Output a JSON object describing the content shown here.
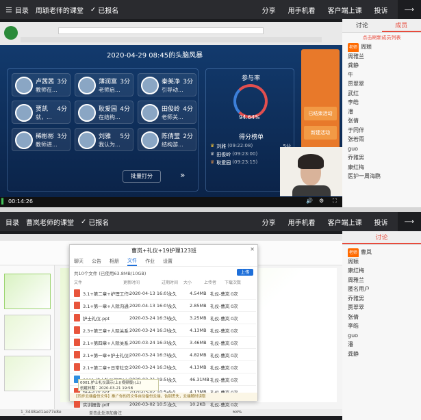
{
  "top": {
    "title_icon": "list-icon",
    "menu_label": "目录",
    "course": "周颖老师的课堂",
    "signin": "已报名",
    "share": "分享",
    "phone": "用手机看",
    "client": "客户端上课",
    "complaint": "投诉"
  },
  "top_chat": {
    "tabs": [
      "讨论",
      "成员"
    ],
    "notice": "点击刷新成员列表",
    "members": [
      {
        "name": "周颖",
        "badge": "老师"
      },
      {
        "name": "周雅兰"
      },
      {
        "name": "龚静"
      },
      {
        "name": "牛"
      },
      {
        "name": "贾翠翠"
      },
      {
        "name": "武红"
      },
      {
        "name": "李皓"
      },
      {
        "name": "潘"
      },
      {
        "name": "张倩"
      },
      {
        "name": "于同伴"
      },
      {
        "name": "张若雨"
      },
      {
        "name": "guo"
      },
      {
        "name": "乔雅男"
      },
      {
        "name": "康红梅"
      },
      {
        "name": "医护一周海鹏"
      }
    ]
  },
  "top_screen": {
    "session": "2020-04-29 08:45的头脑风暴",
    "students": [
      {
        "name": "卢茜茜",
        "score": "3分",
        "desc": "教师在..."
      },
      {
        "name": "薄润富",
        "score": "3分",
        "desc": "老师启..."
      },
      {
        "name": "秦美净",
        "score": "3分",
        "desc": "引导动..."
      },
      {
        "name": "贾凯",
        "score": "4分",
        "desc": "就，..."
      },
      {
        "name": "耿爱园",
        "score": "4分",
        "desc": "在结构..."
      },
      {
        "name": "田俊岭",
        "score": "4分",
        "desc": "老师关..."
      },
      {
        "name": "稀彬彬",
        "score": "3分",
        "desc": "教师进..."
      },
      {
        "name": "刘雅",
        "score": "5分",
        "desc": "我认为..."
      },
      {
        "name": "陈倩莹",
        "score": "2分",
        "desc": "结构游..."
      }
    ],
    "batch_btn": "批量打分",
    "participation_title": "参与率",
    "participation_value": "94.64%",
    "participation_value_num": 94.64,
    "leaderboard_title": "得分榜单",
    "leaders": [
      {
        "name": "刘雅",
        "time": "(09:22:08)",
        "score": "5分"
      },
      {
        "name": "田俊岭",
        "time": "(09:23:00)",
        "score": "4分"
      },
      {
        "name": "耿爱园",
        "time": "(09:23:15)",
        "score": "4分"
      }
    ],
    "side_buttons": [
      "已结束活动",
      "新建活动"
    ],
    "time": "00:14:26"
  },
  "bottom": {
    "menu_label": "目录",
    "course": "曹岚老师的课堂",
    "signin": "已报名",
    "share": "分享",
    "phone": "用手机看",
    "client": "客户端上课",
    "complaint": "投诉"
  },
  "bottom_chat": {
    "tabs": [
      "讨论"
    ],
    "members": [
      {
        "name": "曹岚",
        "badge": "老师"
      },
      {
        "name": "周颖"
      },
      {
        "name": "康红梅"
      },
      {
        "name": "周雅兰"
      },
      {
        "name": "匿名用户"
      },
      {
        "name": "乔雅男"
      },
      {
        "name": "贾翠翠"
      },
      {
        "name": "张倩"
      },
      {
        "name": "李皓"
      },
      {
        "name": "guo"
      },
      {
        "name": "潘"
      },
      {
        "name": "龚静"
      }
    ]
  },
  "file_window": {
    "title": "曹岚+礼仪+19护理123班",
    "tabs": [
      "聊天",
      "公告",
      "相册",
      "文件",
      "作业",
      "设置"
    ],
    "summary": "共10个文件 (已使用63.8MB/10GB)",
    "upload_btn": "上传",
    "columns": [
      "文件",
      "更新时间",
      "过期时间",
      "大小",
      "上传者",
      "下载次数"
    ],
    "files": [
      {
        "name": "3.1+第二章+护理工作中...",
        "time": "2020-04-13 16:05",
        "expire": "永久",
        "size": "4.54MB",
        "uploader": "礼仪-曹岚",
        "dl": "0次"
      },
      {
        "name": "3.1+第一章+人际沟通...",
        "time": "2020-04-13 16:05",
        "expire": "永久",
        "size": "2.85MB",
        "uploader": "礼仪-曹岚",
        "dl": "0次"
      },
      {
        "name": "护士礼仪.ppt",
        "time": "2020-03-24 16:38",
        "expire": "永久",
        "size": "3.25MB",
        "uploader": "礼仪-曹岚",
        "dl": "0次"
      },
      {
        "name": "2.3+第三章+人际关系...",
        "time": "2020-03-24 16:38",
        "expire": "永久",
        "size": "4.13MB",
        "uploader": "礼仪-曹岚",
        "dl": "0次"
      },
      {
        "name": "2.1+第四章+人际关系.ppt",
        "time": "2020-03-24 16:38",
        "expire": "永久",
        "size": "3.46MB",
        "uploader": "礼仪-曹岚",
        "dl": "0次"
      },
      {
        "name": "2.1+第一章+护士礼仪概...",
        "time": "2020-03-24 16:38",
        "expire": "永久",
        "size": "4.82MB",
        "uploader": "礼仪-曹岚",
        "dl": "0次"
      },
      {
        "name": "2.1+第二章+日常社交礼...",
        "time": "2020-03-24 16:38",
        "expire": "永久",
        "size": "4.13MB",
        "uploader": "礼仪-曹岚",
        "dl": "0次"
      },
      {
        "name": "0001.护士礼仪演示(上)...",
        "time": "2020-03-21 19:58",
        "expire": "永久",
        "size": "46.31MB",
        "uploader": "礼仪-曹岚",
        "dl": "0次",
        "video": true
      },
      {
        "name": "护士礼仪.ppt",
        "time": "2020-03-02 10:54",
        "expire": "永久",
        "size": "4.13MB",
        "uploader": "礼仪-曹岚",
        "dl": "0次"
      },
      {
        "name": "实训报告.pdf",
        "time": "2020-03-02 10:51",
        "expire": "永久",
        "size": "10.2KB",
        "uploader": "礼仪-曹岚",
        "dl": "0次"
      }
    ],
    "tooltip_lines": [
      "0001.护士礼仪演示(上)(视频版)(上)",
      "创建日期：2020-03-21 19:58"
    ],
    "footer": "【同步云端备份文件】推广你的同文件自动备份云端，告别丢失，云端随时读取"
  },
  "ppt": {
    "status_left": "1_3448ad1ae77e8e",
    "zoom": "68%",
    "notes": "单击此处添加备注"
  },
  "colors": {
    "accent": "#e84b3c",
    "dark": "#1b1c1f",
    "blue": "#1e6fd9"
  }
}
